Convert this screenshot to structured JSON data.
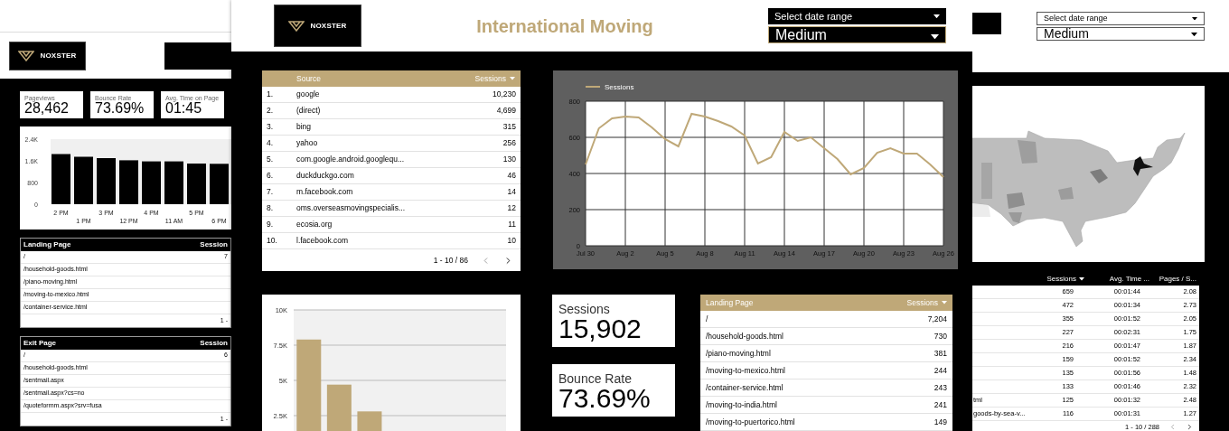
{
  "left_dashboard": {
    "logo": "NOXSTER",
    "scorecards": [
      {
        "label": "Pageviews",
        "value": "28,462"
      },
      {
        "label": "Bounce Rate",
        "value": "73.69%"
      },
      {
        "label": "Avg. Time on Page",
        "value": "01:45"
      }
    ],
    "bar_chart": {
      "chart_data": {
        "type": "bar",
        "categories": [
          "2 PM",
          "1 PM",
          "3 PM",
          "12 PM",
          "4 PM",
          "11 AM",
          "5 PM",
          "6 PM"
        ],
        "values": [
          1850,
          1750,
          1700,
          1620,
          1580,
          1580,
          1500,
          1490
        ],
        "ylim": [
          0,
          2400
        ],
        "yticks": [
          {
            "value": 0,
            "label": "0"
          },
          {
            "value": 800,
            "label": "800"
          },
          {
            "value": 1600,
            "label": "1.6K"
          },
          {
            "value": 2400,
            "label": "2.4K"
          }
        ]
      }
    },
    "landing_table": {
      "columns": [
        "Landing Page",
        "Session"
      ],
      "rows": [
        {
          "page": "/",
          "sessions": "7"
        },
        {
          "page": "/household-goods.html"
        },
        {
          "page": "/piano-moving.html"
        },
        {
          "page": "/moving-to-mexico.html"
        },
        {
          "page": "/container-service.html"
        }
      ],
      "footer": "1 -"
    },
    "exit_table": {
      "columns": [
        "Exit Page",
        "Session"
      ],
      "rows": [
        {
          "page": "/",
          "sessions": "6"
        },
        {
          "page": "/household-goods.html"
        },
        {
          "page": "/sentmail.aspx"
        },
        {
          "page": "/sentmail.aspx?cs=no"
        },
        {
          "page": "/quoteformm.aspx?srv=fusa"
        }
      ],
      "footer": "1 -"
    }
  },
  "center_dashboard": {
    "logo": "NOXSTER",
    "title": "International Moving",
    "date_range": {
      "placeholder": "Select date range"
    },
    "medium_filter": {
      "value": "Medium"
    },
    "source_table": {
      "columns": [
        "Source",
        "Sessions"
      ],
      "rows": [
        {
          "rank": "1.",
          "source": "google",
          "sessions": "10,230"
        },
        {
          "rank": "2.",
          "source": "(direct)",
          "sessions": "4,699"
        },
        {
          "rank": "3.",
          "source": "bing",
          "sessions": "315"
        },
        {
          "rank": "4.",
          "source": "yahoo",
          "sessions": "256"
        },
        {
          "rank": "5.",
          "source": "com.google.android.googlequ...",
          "sessions": "130"
        },
        {
          "rank": "6.",
          "source": "duckduckgo.com",
          "sessions": "46"
        },
        {
          "rank": "7.",
          "source": "m.facebook.com",
          "sessions": "14"
        },
        {
          "rank": "8.",
          "source": "oms.overseasmovingspecialis...",
          "sessions": "12"
        },
        {
          "rank": "9.",
          "source": "ecosia.org",
          "sessions": "11"
        },
        {
          "rank": "10.",
          "source": "l.facebook.com",
          "sessions": "10"
        }
      ],
      "pagination": "1 - 10 / 86"
    },
    "line_chart": {
      "chart_data": {
        "type": "line",
        "categories": [
          "Jul 30",
          null,
          null,
          "Aug 2",
          null,
          null,
          "Aug 5",
          null,
          null,
          "Aug 8",
          null,
          null,
          "Aug 11",
          null,
          null,
          "Aug 14",
          null,
          null,
          "Aug 17",
          null,
          null,
          "Aug 20",
          null,
          null,
          "Aug 23",
          null,
          null,
          "Aug 26"
        ],
        "series": [
          {
            "name": "Sessions",
            "color": "#bfa878",
            "values": [
              450,
              650,
              705,
              715,
              710,
              655,
              590,
              550,
              730,
              715,
              690,
              660,
              610,
              455,
              490,
              630,
              580,
              600,
              540,
              480,
              395,
              430,
              515,
              540,
              510,
              510,
              450,
              380
            ]
          }
        ],
        "ylim": [
          0,
          800
        ],
        "yticks": [
          0,
          200,
          400,
          600,
          800
        ],
        "grid": true
      }
    },
    "bar_chart": {
      "chart_data": {
        "type": "bar",
        "values": [
          7900,
          4700,
          2800,
          null,
          null,
          null,
          null
        ],
        "grid": true,
        "ylim": [
          1410,
          11090
        ],
        "yticks": [
          {
            "value": 2500,
            "label": "2.5K"
          },
          {
            "value": 5000,
            "label": "5K"
          },
          {
            "value": 7500,
            "label": "7.5K"
          },
          {
            "value": 10000,
            "label": "10K"
          }
        ]
      }
    },
    "scorecards": [
      {
        "label": "Sessions",
        "value": "15,902"
      },
      {
        "label": "Bounce Rate",
        "value": "73.69%"
      }
    ],
    "landing_table": {
      "columns": [
        "Landing Page",
        "Sessions"
      ],
      "rows": [
        {
          "page": "/",
          "sessions": "7,204"
        },
        {
          "page": "/household-goods.html",
          "sessions": "730"
        },
        {
          "page": "/piano-moving.html",
          "sessions": "381"
        },
        {
          "page": "/moving-to-mexico.html",
          "sessions": "244"
        },
        {
          "page": "/container-service.html",
          "sessions": "243"
        },
        {
          "page": "/moving-to-india.html",
          "sessions": "241"
        },
        {
          "page": "/moving-to-puertorico.html",
          "sessions": "149"
        }
      ]
    }
  },
  "right_dashboard": {
    "date_range": {
      "placeholder": "Select date range"
    },
    "medium_filter": {
      "value": "Medium"
    },
    "table": {
      "columns": [
        "Sessions",
        "Avg. Time ...",
        "Pages / S..."
      ],
      "rows": [
        {
          "sessions": "659",
          "avg_time": "00:01:44",
          "pages": "2.08"
        },
        {
          "sessions": "472",
          "avg_time": "00:01:34",
          "pages": "2.73"
        },
        {
          "sessions": "355",
          "avg_time": "00:01:52",
          "pages": "2.05"
        },
        {
          "sessions": "227",
          "avg_time": "00:02:31",
          "pages": "1.75"
        },
        {
          "sessions": "216",
          "avg_time": "00:01:47",
          "pages": "1.87"
        },
        {
          "sessions": "159",
          "avg_time": "00:01:52",
          "pages": "2.34"
        },
        {
          "sessions": "135",
          "avg_time": "00:01:56",
          "pages": "1.48"
        },
        {
          "sessions": "133",
          "avg_time": "00:01:46",
          "pages": "2.32"
        },
        {
          "page": "tml",
          "sessions": "125",
          "avg_time": "00:01:32",
          "pages": "2.48"
        },
        {
          "page": "goods-by-sea-v...",
          "sessions": "116",
          "avg_time": "00:01:31",
          "pages": "1.27"
        }
      ],
      "pagination": "1 - 10 / 288"
    }
  }
}
